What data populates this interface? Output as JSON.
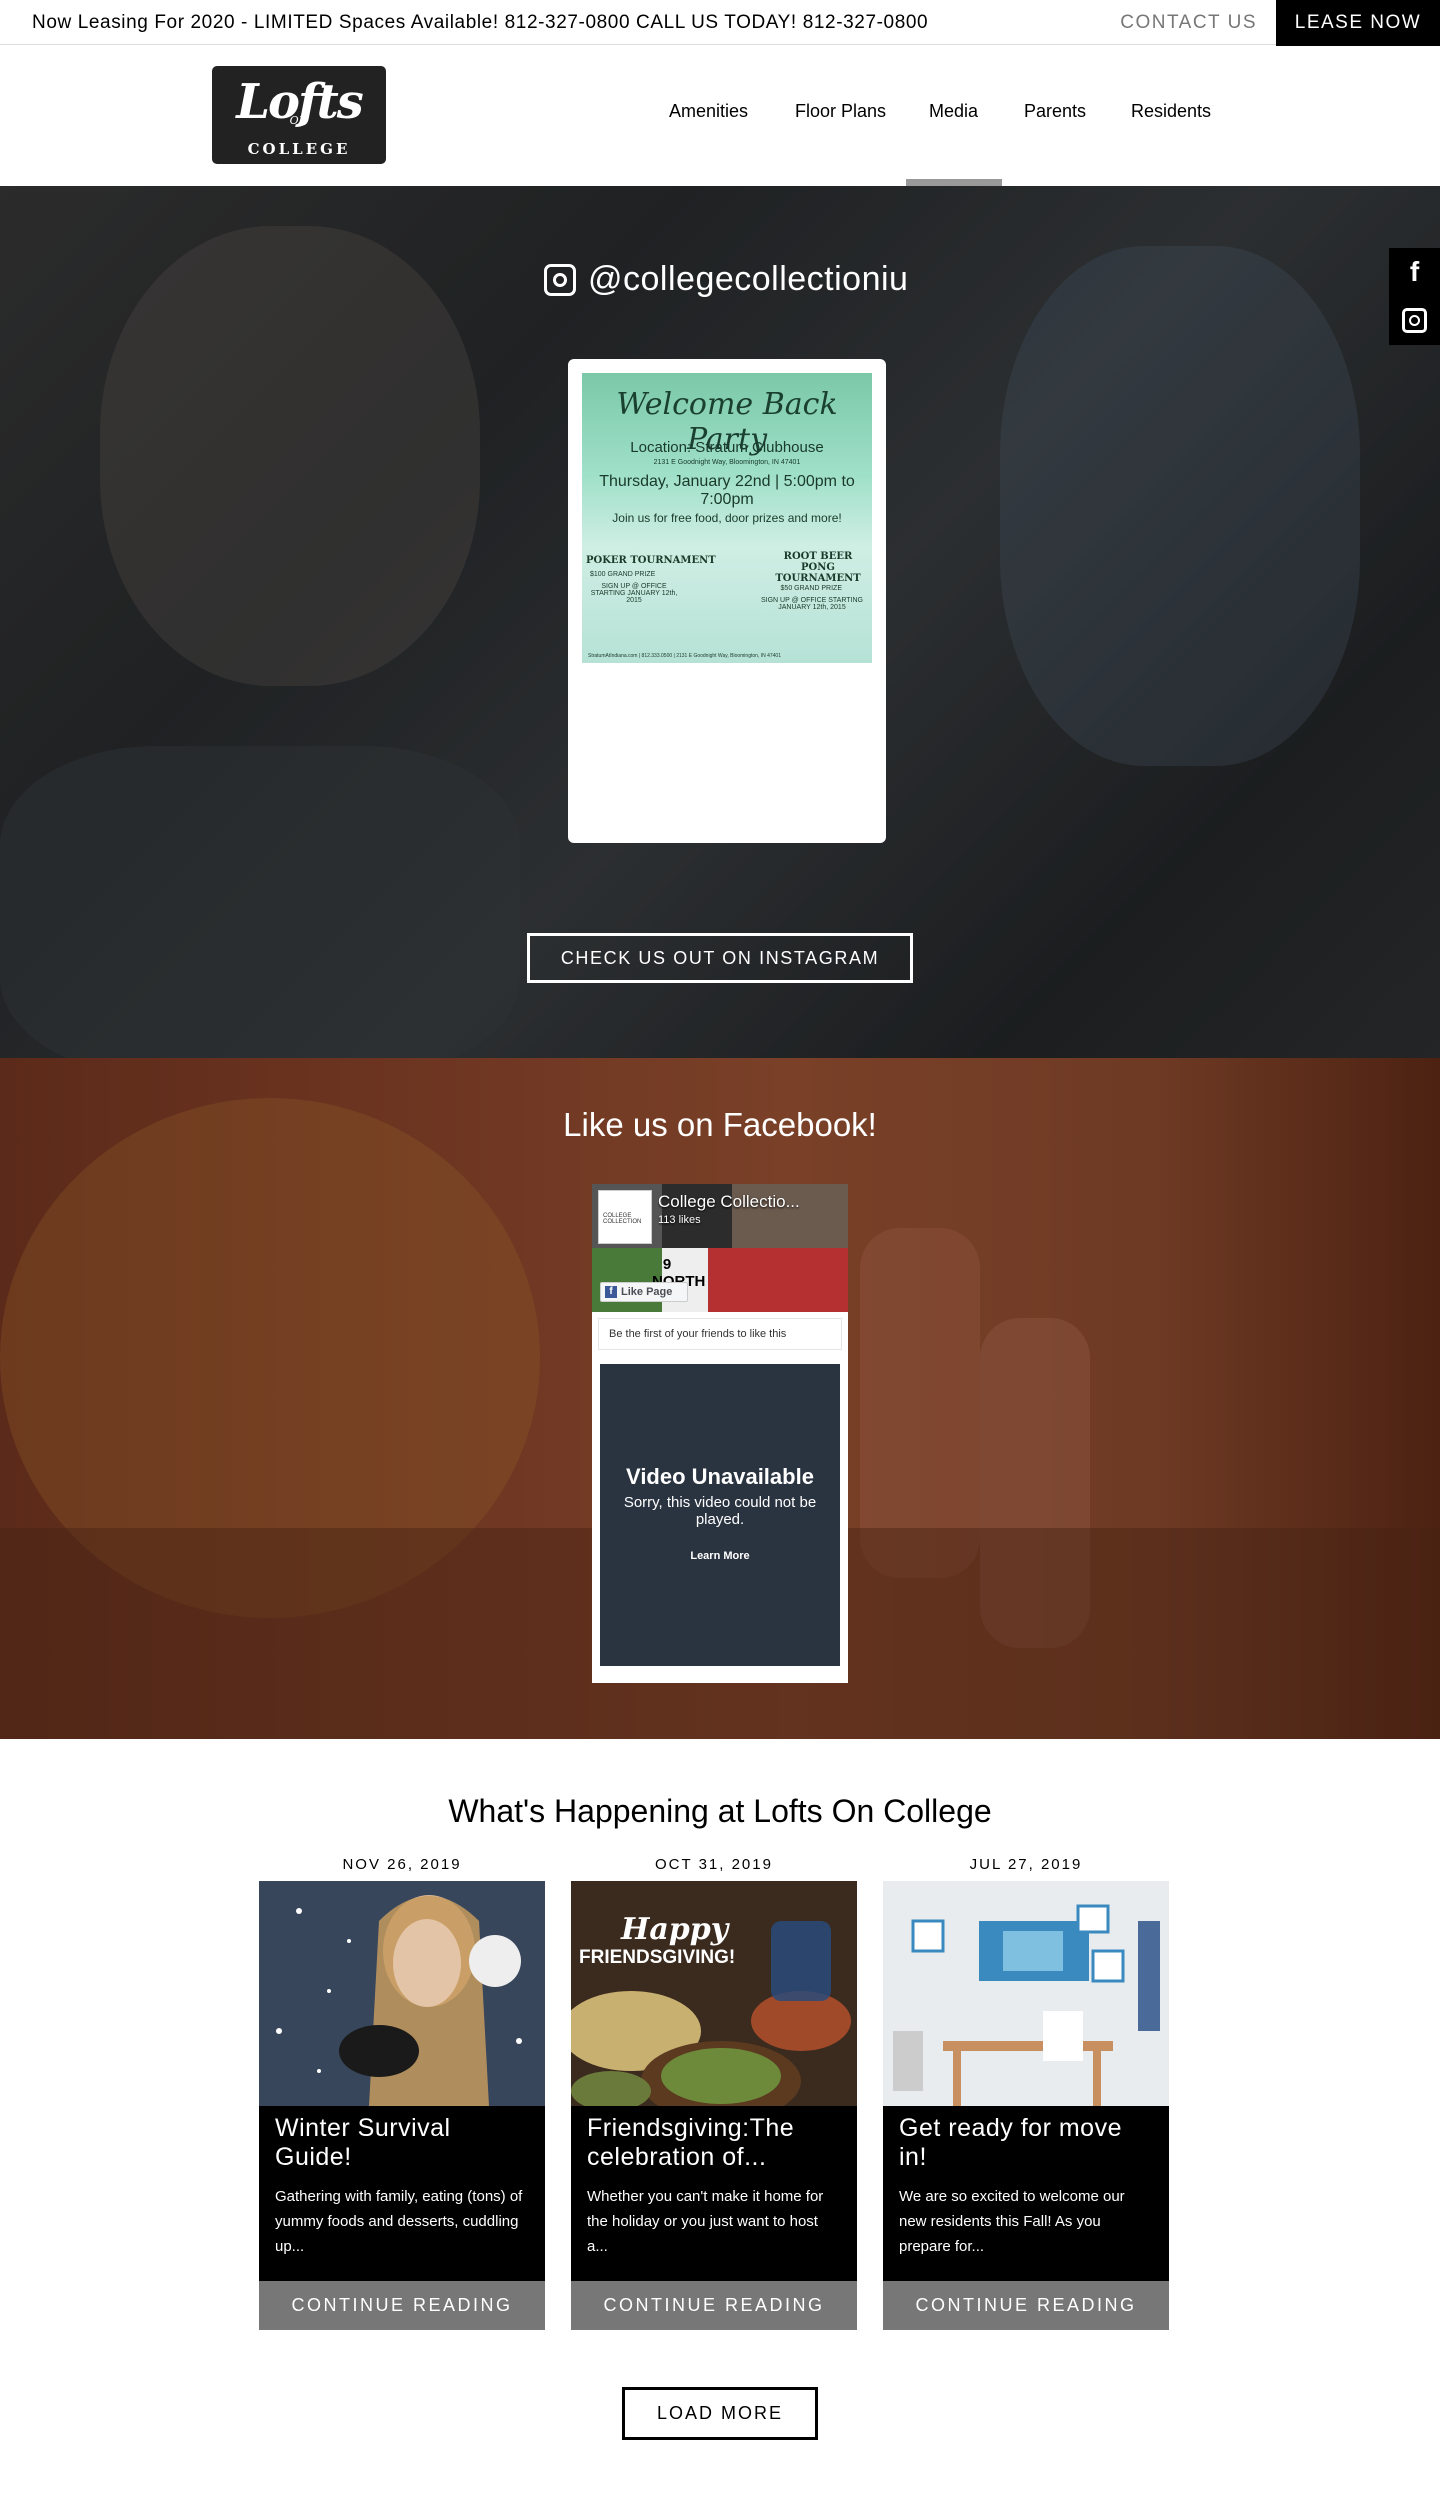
{
  "topbar": {
    "announcement": "Now Leasing For 2020 - LIMITED Spaces Available! 812-327-0800 CALL US TODAY! 812-327-0800",
    "contact_label": "CONTACT US",
    "lease_label": "LEASE NOW"
  },
  "logo": {
    "line1": "Lofts",
    "line2": "ON",
    "line3": "COLLEGE"
  },
  "nav": {
    "items": [
      {
        "label": "Amenities"
      },
      {
        "label": "Floor Plans"
      },
      {
        "label": "Media",
        "active": true
      },
      {
        "label": "Parents"
      },
      {
        "label": "Residents"
      }
    ]
  },
  "instagram": {
    "handle": "@collegecollectioniu",
    "post": {
      "title": "Welcome Back Party",
      "location": "Location: Stratum Clubhouse",
      "address": "2131 E Goodnight Way, Bloomington, IN 47401",
      "date": "Thursday, January 22nd | 5:00pm to 7:00pm",
      "join": "Join us for free food, door prizes and more!",
      "poker_title": "POKER TOURNAMENT",
      "poker_prize": "$100 GRAND PRIZE",
      "poker_signup": "SIGN UP @ OFFICE STARTING JANUARY 12th, 2015",
      "rb_title": "ROOT BEER PONG TOURNAMENT",
      "rb_prize": "$50 GRAND PRIZE",
      "rb_signup": "SIGN UP @ OFFICE STARTING JANUARY 12th, 2015",
      "footer": "StratumAtIndiana.com | 812.333.0500 | 2131 E Goodnight Way, Bloomington, IN 47401"
    },
    "button_label": "CHECK US OUT ON INSTAGRAM"
  },
  "social_side": {
    "facebook_glyph": "f"
  },
  "facebook": {
    "heading": "Like us on Facebook!",
    "page_name": "College Collectio...",
    "likes": "113 likes",
    "avatar_text": "COLLEGE COLLECTION",
    "cover_text": "9 NORTH",
    "like_button": "Like Page",
    "friends_text": "Be the first of your friends to like this",
    "video_title": "Video Unavailable",
    "video_sorry": "Sorry, this video could not be played.",
    "video_learn": "Learn More"
  },
  "news": {
    "heading": "What's Happening at Lofts On College",
    "posts": [
      {
        "date": "NOV 26, 2019",
        "title": "Winter Survival Guide!",
        "excerpt": "Gathering with family, eating (tons) of yummy foods and desserts, cuddling up...",
        "cta": "CONTINUE READING"
      },
      {
        "date": "OCT 31, 2019",
        "title": "Friendsgiving:The celebration of...",
        "excerpt": "Whether you can't make it home for the holiday or you just want to host a...",
        "cta": "CONTINUE READING",
        "image_text1": "Happy",
        "image_text2": "FRIENDSGIVING!"
      },
      {
        "date": "JUL 27, 2019",
        "title": "Get ready for move in!",
        "excerpt": "We are so excited to welcome our new residents this Fall! As you prepare for...",
        "cta": "CONTINUE READING"
      }
    ],
    "load_more": "LOAD MORE"
  }
}
